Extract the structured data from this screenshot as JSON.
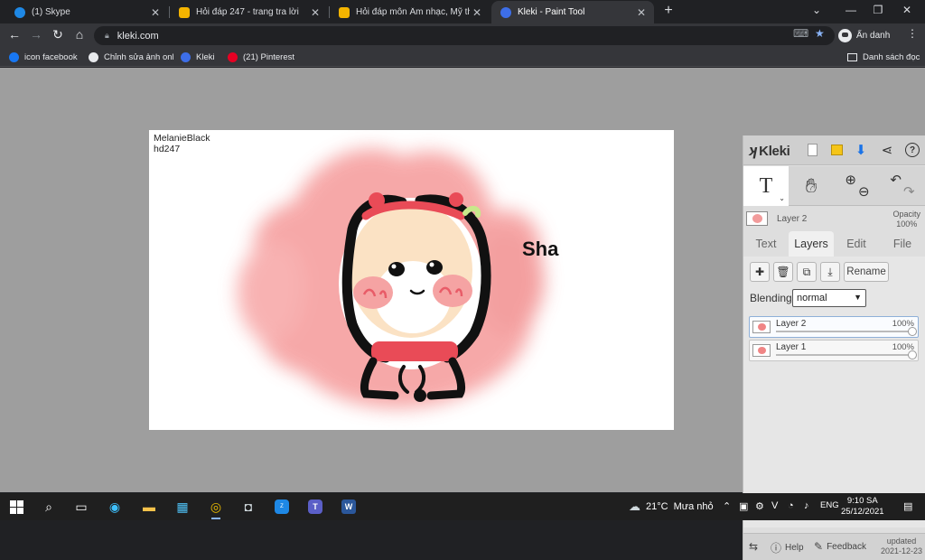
{
  "browser": {
    "tabs": [
      {
        "title": "(1) Skype",
        "color": "#1e88e5",
        "active": false
      },
      {
        "title": "Hỏi đáp 247 - trang tra lời",
        "color": "#f4b400",
        "active": false
      },
      {
        "title": "Hỏi đáp môn Âm nhạc, Mỹ thuật",
        "color": "#f4b400",
        "active": false
      },
      {
        "title": "Kleki - Paint Tool",
        "color": "#3d6ee8",
        "active": true
      }
    ],
    "url": "kleki.com",
    "profile_label": "Ẩn danh",
    "bookmarks": [
      {
        "label": "icon facebook",
        "color": "#1877f2"
      },
      {
        "label": "Chỉnh sửa ảnh onl",
        "color": "#e8eaed"
      },
      {
        "label": "Kleki",
        "color": "#3d6ee8"
      },
      {
        "label": "(21) Pinterest",
        "color": "#e60023"
      }
    ],
    "reading_list_label": "Danh sách đọc"
  },
  "canvas": {
    "signature_line1": "MelanieBlack",
    "signature_line2": "hd247",
    "drawing_text": "Sha"
  },
  "kleki": {
    "logo_text": "Kleki",
    "current_layer": "Layer 2",
    "opacity_label": "Opacity",
    "opacity_value": "100%",
    "tabs": [
      "Text",
      "Layers",
      "Edit",
      "File"
    ],
    "active_tab": "Layers",
    "rename_label": "Rename",
    "blending_label": "Blending",
    "blending_value": "normal",
    "layers": [
      {
        "name": "Layer 2",
        "opacity": "100%",
        "selected": true
      },
      {
        "name": "Layer 1",
        "opacity": "100%",
        "selected": false
      }
    ],
    "help_label": "Help",
    "feedback_label": "Feedback",
    "updated_label": "updated",
    "updated_date": "2021-12-23"
  },
  "taskbar": {
    "weather_temp": "21°C",
    "weather_text": "Mưa nhỏ",
    "language": "ENG",
    "time": "9:10 SA",
    "date": "25/12/2021"
  }
}
